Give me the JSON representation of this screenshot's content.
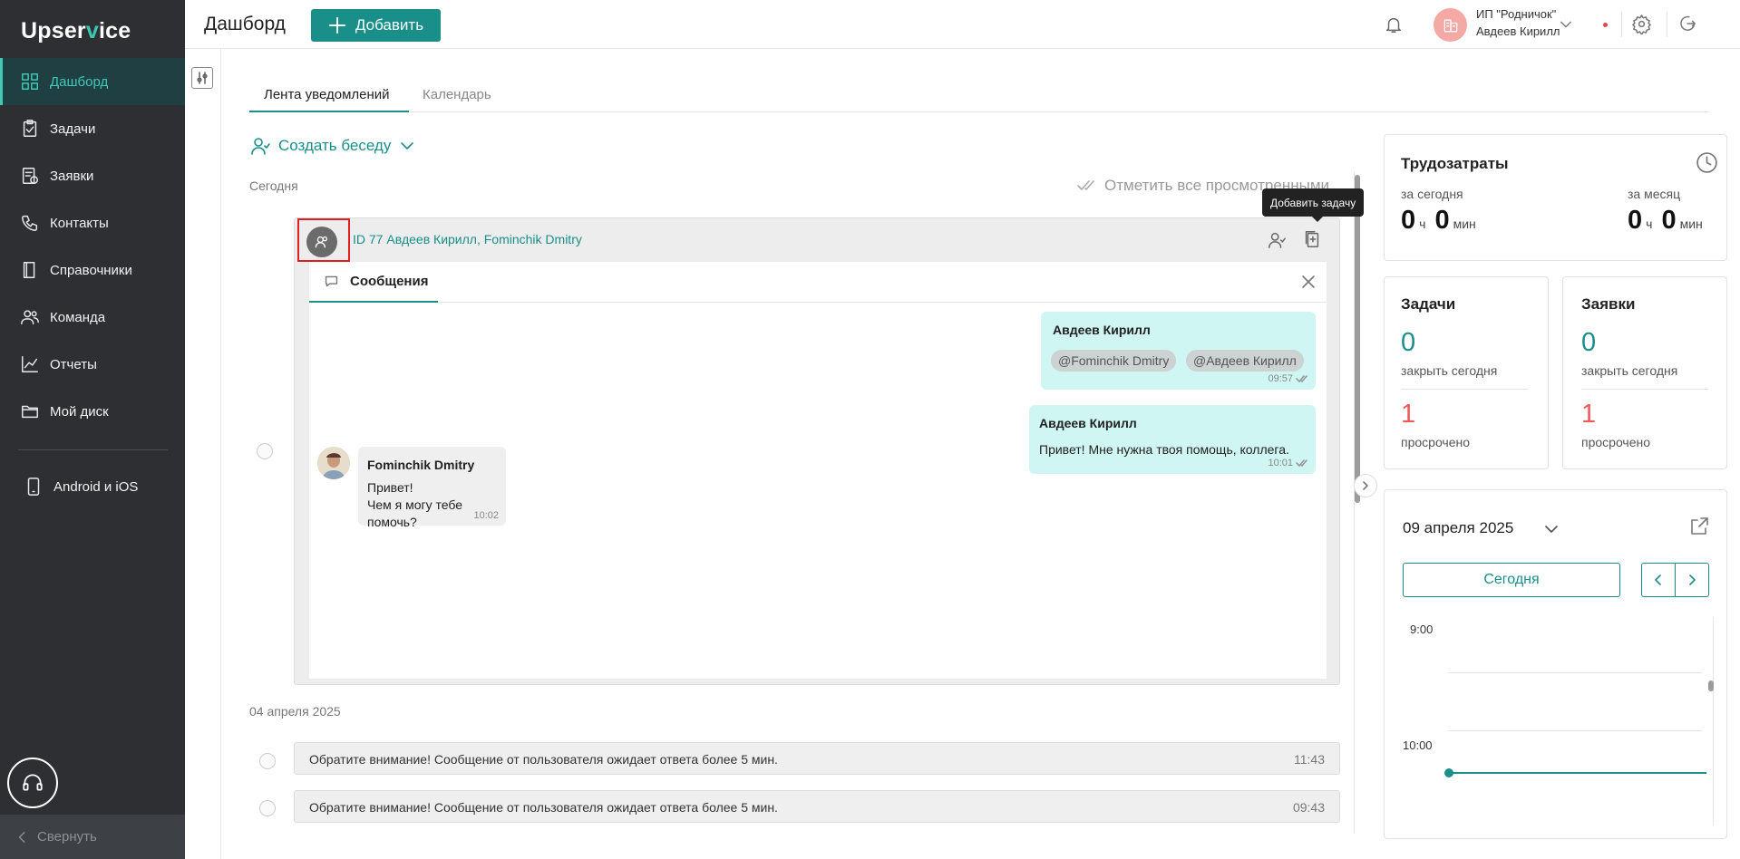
{
  "app": {
    "logo_left": "Upser",
    "logo_v": "v",
    "logo_right": "ice"
  },
  "sidebar": {
    "items": [
      {
        "label": "Дашборд",
        "icon": "grid-icon"
      },
      {
        "label": "Задачи",
        "icon": "clipboard-icon"
      },
      {
        "label": "Заявки",
        "icon": "request-icon"
      },
      {
        "label": "Контакты",
        "icon": "phone-icon"
      },
      {
        "label": "Справочники",
        "icon": "book-icon"
      },
      {
        "label": "Команда",
        "icon": "team-icon"
      },
      {
        "label": "Отчеты",
        "icon": "chart-icon"
      },
      {
        "label": "Мой диск",
        "icon": "folder-icon"
      },
      {
        "label": "Android и iOS",
        "icon": "mobile-icon"
      }
    ],
    "collapse_label": "Свернуть"
  },
  "header": {
    "title": "Дашборд",
    "add_label": "Добавить",
    "company": "ИП \"Родничок\"",
    "user": "Авдеев Кирилл"
  },
  "tabs": {
    "feed": "Лента уведомлений",
    "calendar": "Календарь"
  },
  "feed": {
    "create_chat": "Создать беседу",
    "today": "Сегодня",
    "mark_all": "Отметить все просмотренными",
    "conversation": {
      "title": "ID 77 Авдеев Кирилл, Fominchik Dmitry",
      "tooltip": "Добавить задачу",
      "messages_tab": "Сообщения",
      "messages": [
        {
          "author": "Авдеев Кирилл",
          "mentions": [
            "@Fominchik Dmitry",
            "@Авдеев Кирилл"
          ],
          "time": "09:57"
        },
        {
          "author": "Авдеев Кирилл",
          "text": "Привет! Мне нужна твоя помощь, коллега.",
          "time": "10:01"
        },
        {
          "author": "Fominchik Dmitry",
          "text_line1": "Привет!",
          "text_line2": "Чем я могу тебе помочь?",
          "time": "10:02"
        }
      ]
    },
    "older_date": "04 апреля 2025",
    "notifications": [
      {
        "text": "Обратите внимание! Сообщение от пользователя ожидает ответа более 5 мин.",
        "time": "11:43"
      },
      {
        "text": "Обратите внимание! Сообщение от пользователя ожидает ответа более 5 мин.",
        "time": "09:43"
      }
    ]
  },
  "labor": {
    "title": "Трудозатраты",
    "today_label": "за сегодня",
    "month_label": "за месяц",
    "today_h": "0",
    "today_m": "0",
    "month_h": "0",
    "month_m": "0",
    "h_unit": "ч",
    "m_unit": "мин"
  },
  "tasks": {
    "title": "Задачи",
    "close_today": "0",
    "close_today_label": "закрыть сегодня",
    "overdue": "1",
    "overdue_label": "просрочено"
  },
  "requests": {
    "title": "Заявки",
    "close_today": "0",
    "close_today_label": "закрыть сегодня",
    "overdue": "1",
    "overdue_label": "просрочено"
  },
  "calendar": {
    "date": "09 апреля 2025",
    "today_button": "Сегодня",
    "hours": [
      "9:00",
      "10:00"
    ]
  },
  "colors": {
    "accent": "#1a8f8a",
    "sidebar": "#2d2f33",
    "danger": "#f05a5a",
    "bubble_mine": "#d0f6f4"
  }
}
